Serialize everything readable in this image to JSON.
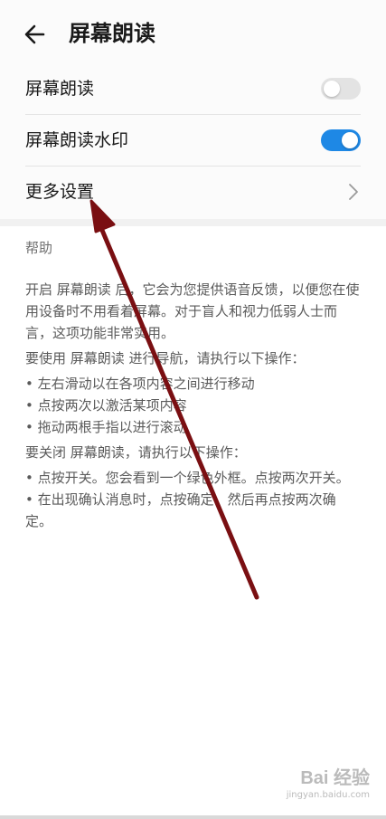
{
  "header": {
    "back_icon": "arrow-left-icon",
    "title": "屏幕朗读"
  },
  "settings": {
    "items": [
      {
        "label": "屏幕朗读",
        "control": "toggle",
        "on": false
      },
      {
        "label": "屏幕朗读水印",
        "control": "toggle",
        "on": true
      },
      {
        "label": "更多设置",
        "control": "chevron-right-icon"
      }
    ]
  },
  "help": {
    "title": "帮助",
    "paragraphs": [
      "开启 屏幕朗读 后，它会为您提供语音反馈，以便您在使用设备时不用看着屏幕。对于盲人和视力低弱人士而言，这项功能非常实用。",
      "要使用 屏幕朗读 进行导航，请执行以下操作：",
      "• 左右滑动以在各项内容之间进行移动",
      "• 点按两次以激活某项内容",
      "• 拖动两根手指以进行滚动",
      "要关闭 屏幕朗读，请执行以下操作：",
      "• 点按开关。您会看到一个绿色外框。点按两次开关。",
      "• 在出现确认消息时，点按确定，然后再点按两次确定。"
    ]
  },
  "watermark": {
    "logo": "Bai 经验",
    "url": "jingyan.baidu.com"
  },
  "colors": {
    "accent": "#1e88e5",
    "toggle_off": "#e3e3e3",
    "annotation_arrow": "#7a0f12"
  }
}
